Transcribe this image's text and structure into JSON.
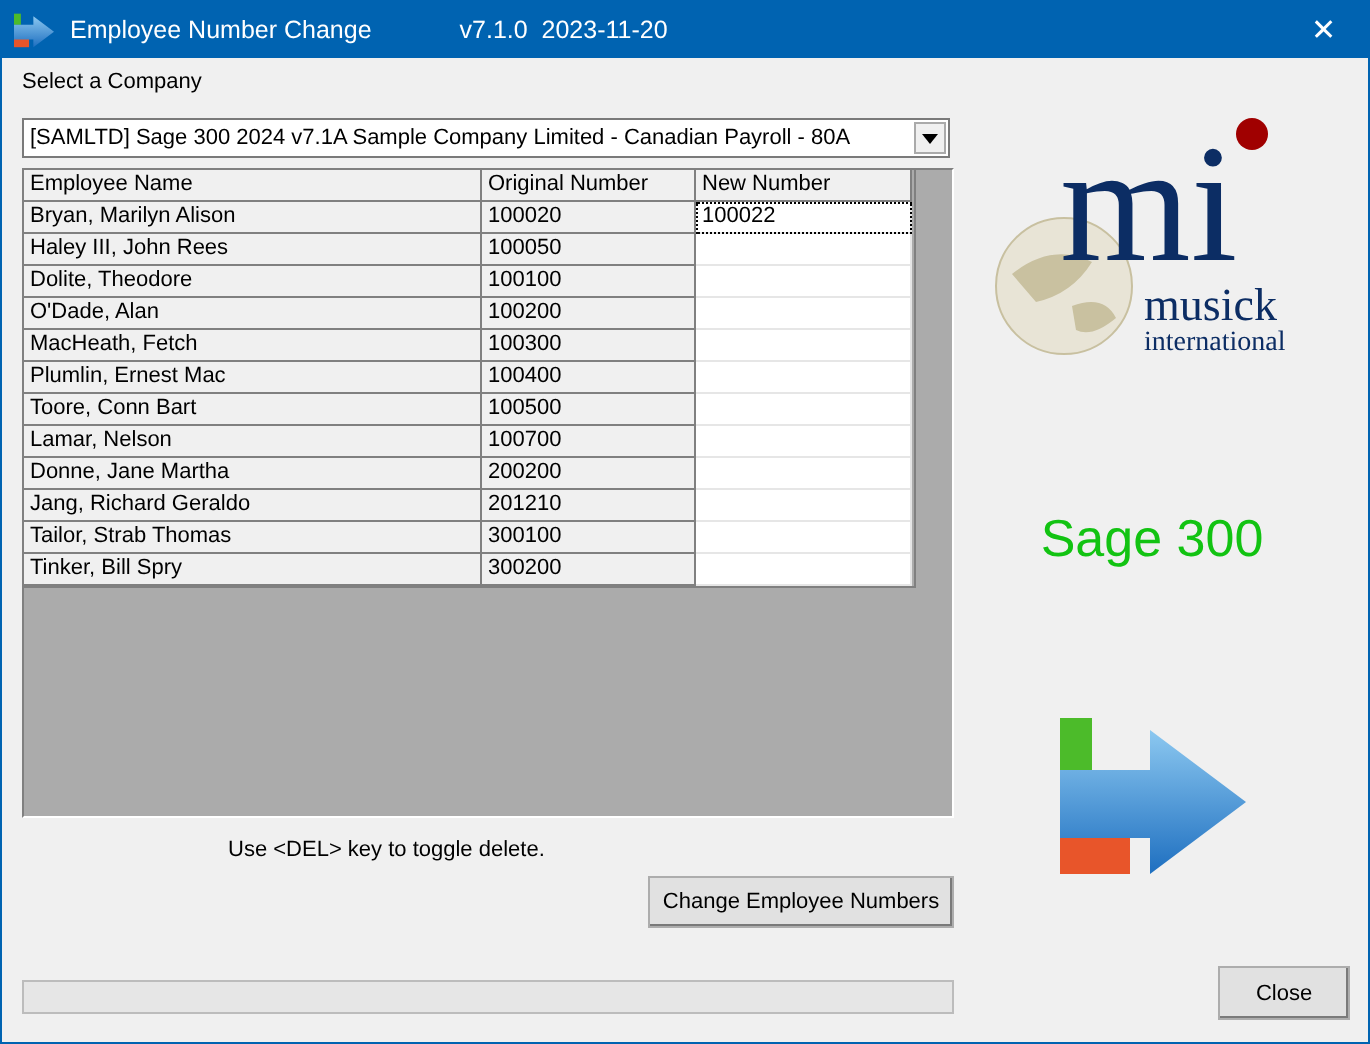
{
  "window": {
    "title": "Employee Number Change",
    "version": "v7.1.0  2023-11-20",
    "close_glyph": "✕"
  },
  "company": {
    "label": "Select a Company",
    "value": "[SAMLTD] Sage 300 2024 v7.1A Sample Company Limited - Canadian Payroll - 80A"
  },
  "table": {
    "columns": [
      "Employee Name",
      "Original Number",
      "New Number"
    ],
    "rows": [
      {
        "name": "Bryan, Marilyn Alison",
        "original": "100020",
        "new_number": "100022",
        "focused": true
      },
      {
        "name": "Haley III, John Rees",
        "original": "100050",
        "focused": false
      },
      {
        "name": "Dolite, Theodore",
        "original": "100100",
        "focused": false
      },
      {
        "name": "O'Dade, Alan",
        "original": "100200",
        "focused": false
      },
      {
        "name": "MacHeath, Fetch",
        "original": "100300",
        "focused": false
      },
      {
        "name": "Plumlin, Ernest Mac",
        "original": "100400",
        "focused": false
      },
      {
        "name": "Toore, Conn Bart",
        "original": "100500",
        "focused": false
      },
      {
        "name": "Lamar, Nelson",
        "original": "100700",
        "focused": false
      },
      {
        "name": "Donne, Jane Martha",
        "original": "200200",
        "focused": false
      },
      {
        "name": "Jang, Richard Geraldo",
        "original": "201210",
        "focused": false
      },
      {
        "name": "Tailor, Strab Thomas",
        "original": "300100",
        "focused": false
      },
      {
        "name": "Tinker, Bill Spry",
        "original": "300200",
        "focused": false
      }
    ]
  },
  "hint": "Use <DEL> key to toggle delete.",
  "change_button": "Change Employee Numbers",
  "progress": {
    "level": 0
  },
  "logo": {
    "mark": "mi",
    "name": "musick",
    "tagline": "international"
  },
  "product": "Sage 300",
  "close_button": "Close"
}
